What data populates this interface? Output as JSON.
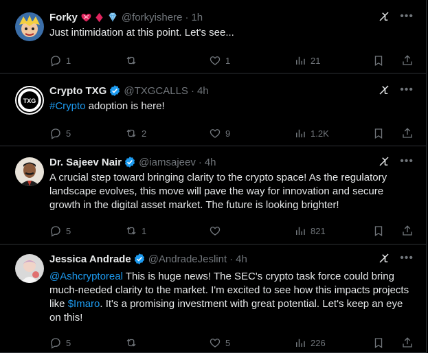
{
  "tweets": [
    {
      "name": "Forky",
      "handle": "@forkyishere",
      "time": "1h",
      "text_parts": [
        {
          "t": "Just intimidation at this point. Let's see...",
          "link": false
        }
      ],
      "replies": "1",
      "reposts": "",
      "likes": "1",
      "views": "21",
      "verified": false,
      "emojis": [
        "heart-with-ribbon",
        "red-diamond",
        "gem"
      ]
    },
    {
      "name": "Crypto TXG",
      "handle": "@TXGCALLS",
      "time": "4h",
      "text_parts": [
        {
          "t": "#Crypto",
          "link": true
        },
        {
          "t": " adoption is here!",
          "link": false
        }
      ],
      "replies": "5",
      "reposts": "2",
      "likes": "9",
      "views": "1.2K",
      "verified": true,
      "avatar_text": "TXG"
    },
    {
      "name": "Dr. Sajeev Nair",
      "handle": "@iamsajeev",
      "time": "4h",
      "text_parts": [
        {
          "t": "A crucial step toward bringing clarity to the crypto space! As the regulatory landscape evolves, this move will pave the way for innovation and secure growth in the digital asset market. The future is looking brighter!",
          "link": false
        }
      ],
      "replies": "5",
      "reposts": "1",
      "likes": "",
      "views": "821",
      "verified": true
    },
    {
      "name": "Jessica Andrade",
      "handle": "@AndradeJeslint",
      "time": "4h",
      "text_parts": [
        {
          "t": "@Ashcryptoreal",
          "link": true
        },
        {
          "t": " This is huge news! The SEC's crypto task force could bring much-needed clarity to the market. I'm excited to see how this impacts projects like ",
          "link": false
        },
        {
          "t": "$Imaro",
          "link": true
        },
        {
          "t": ". It's a promising investment with great potential. Let's keep an eye on this!",
          "link": false
        }
      ],
      "replies": "5",
      "reposts": "",
      "likes": "5",
      "views": "226",
      "verified": true
    }
  ],
  "colors": {
    "bg": "#000000",
    "text": "#e7e9ea",
    "muted": "#71767b",
    "link": "#1d9bf0",
    "verified": "#1d9bf0",
    "border": "#2f3336"
  },
  "icons": [
    "reply-icon",
    "repost-icon",
    "like-icon",
    "views-icon",
    "bookmark-icon",
    "share-icon",
    "grok-icon",
    "more-icon",
    "verified-badge-icon"
  ]
}
